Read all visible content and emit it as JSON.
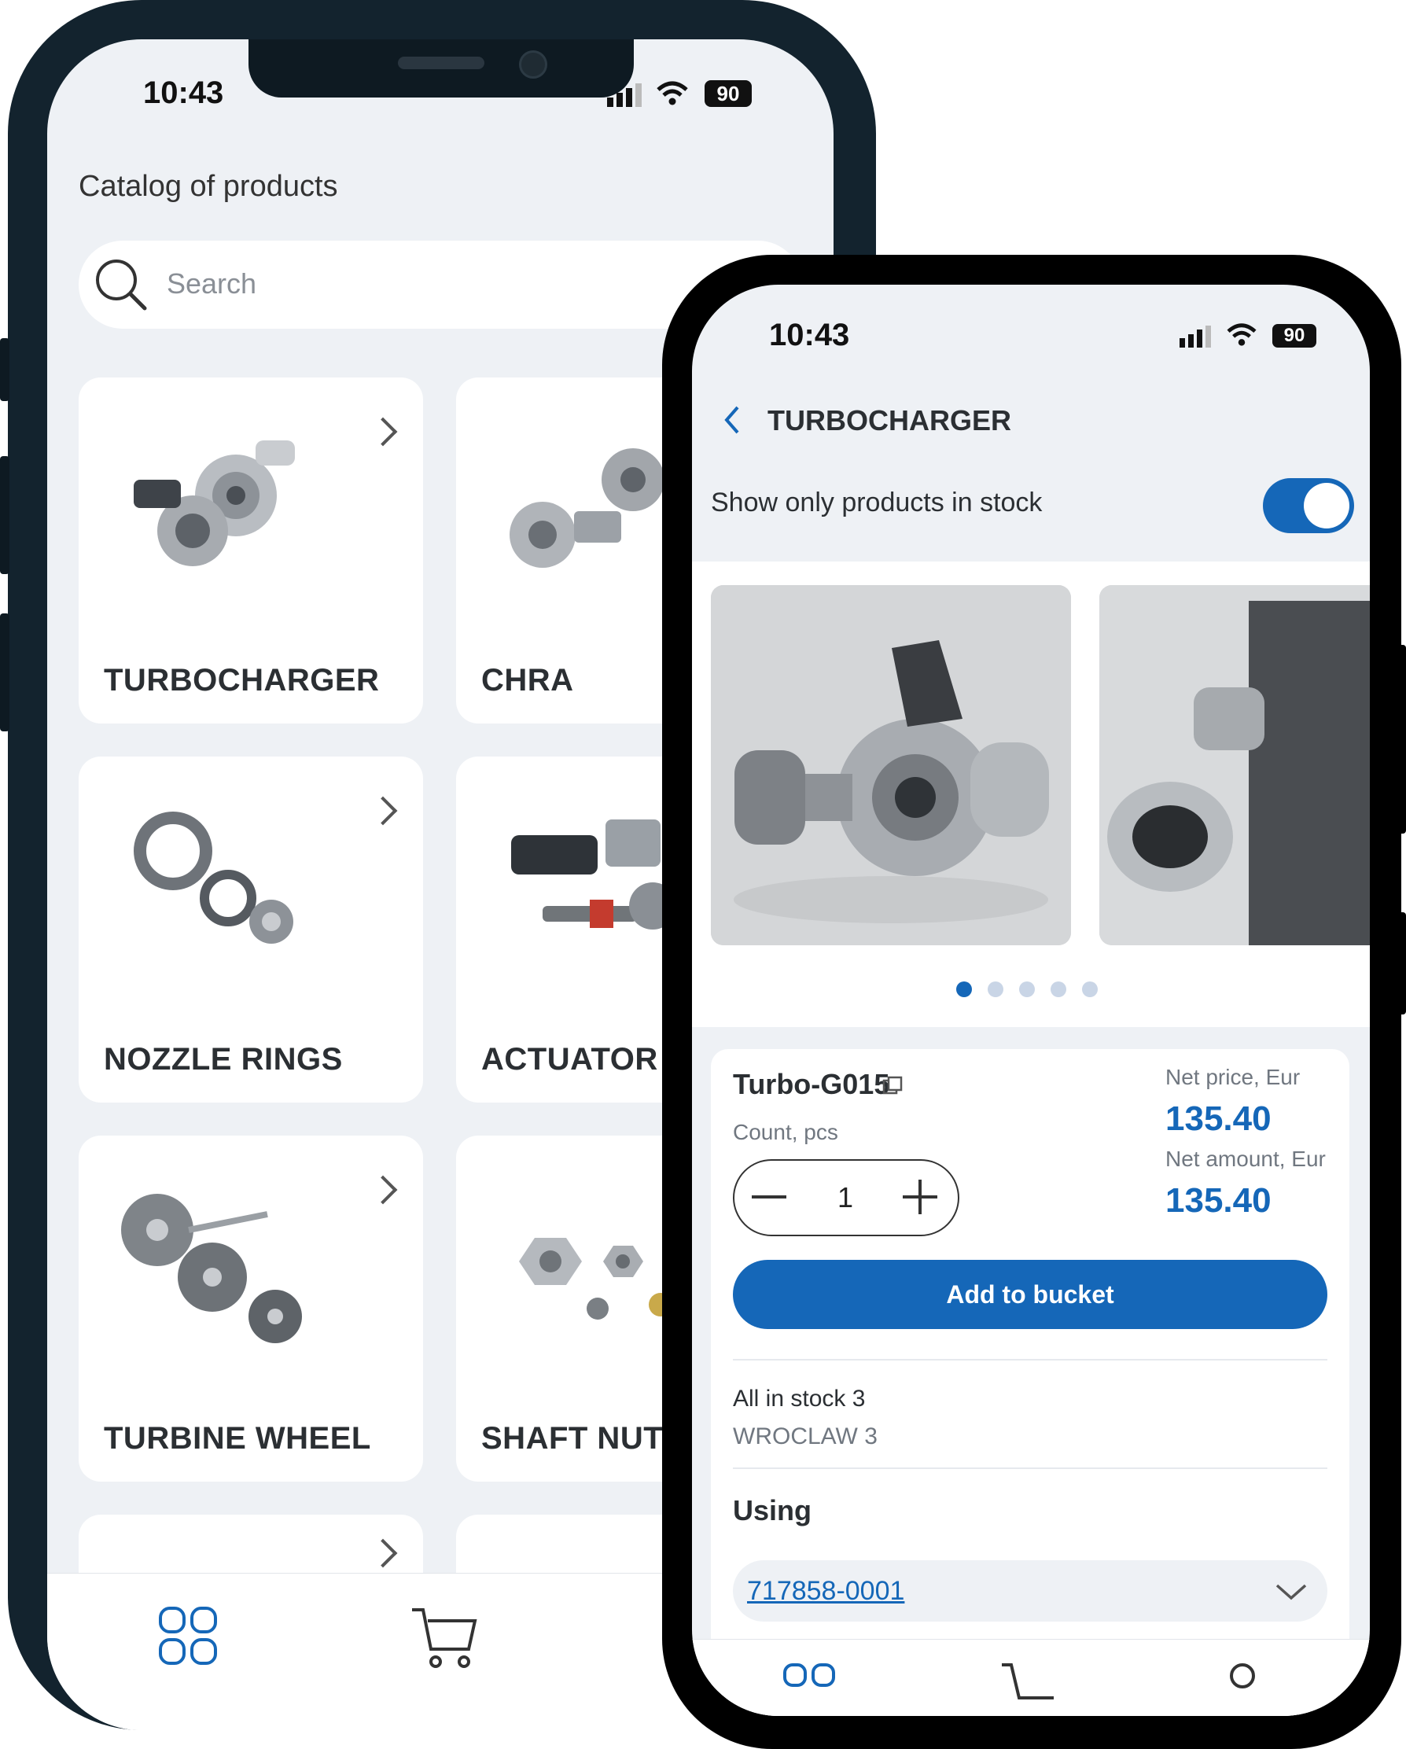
{
  "left": {
    "status": {
      "time": "10:43",
      "battery": "90"
    },
    "title": "Catalog of products",
    "search": {
      "placeholder": "Search"
    },
    "categories": [
      {
        "label": "TURBOCHARGER"
      },
      {
        "label": "CHRA"
      },
      {
        "label": "NOZZLE RINGS"
      },
      {
        "label": "ACTUATOR"
      },
      {
        "label": "TURBINE WHEEL"
      },
      {
        "label": "SHAFT NUT"
      }
    ],
    "tabs": [
      {
        "icon": "grid-icon"
      },
      {
        "icon": "cart-icon"
      }
    ]
  },
  "right": {
    "status": {
      "time": "10:43",
      "battery": "90"
    },
    "header": {
      "title": "TURBOCHARGER",
      "back_icon": "chevron-left-icon"
    },
    "filter": {
      "label": "Show only products in stock",
      "enabled": true
    },
    "gallery": {
      "dots": 5,
      "active": 0
    },
    "product": {
      "name": "Turbo-G015",
      "count_label": "Count, pcs",
      "count_value": "1",
      "net_price_label": "Net price, Eur",
      "net_price": "135.40",
      "net_amount_label": "Net amount, Eur",
      "net_amount": "135.40",
      "add_button": "Add to bucket"
    },
    "stock": {
      "total": "All in stock 3",
      "location": "WROCLAW 3"
    },
    "using": {
      "title": "Using",
      "item": "717858-0001"
    }
  },
  "colors": {
    "accent": "#1567b8",
    "background": "#eef1f5"
  }
}
